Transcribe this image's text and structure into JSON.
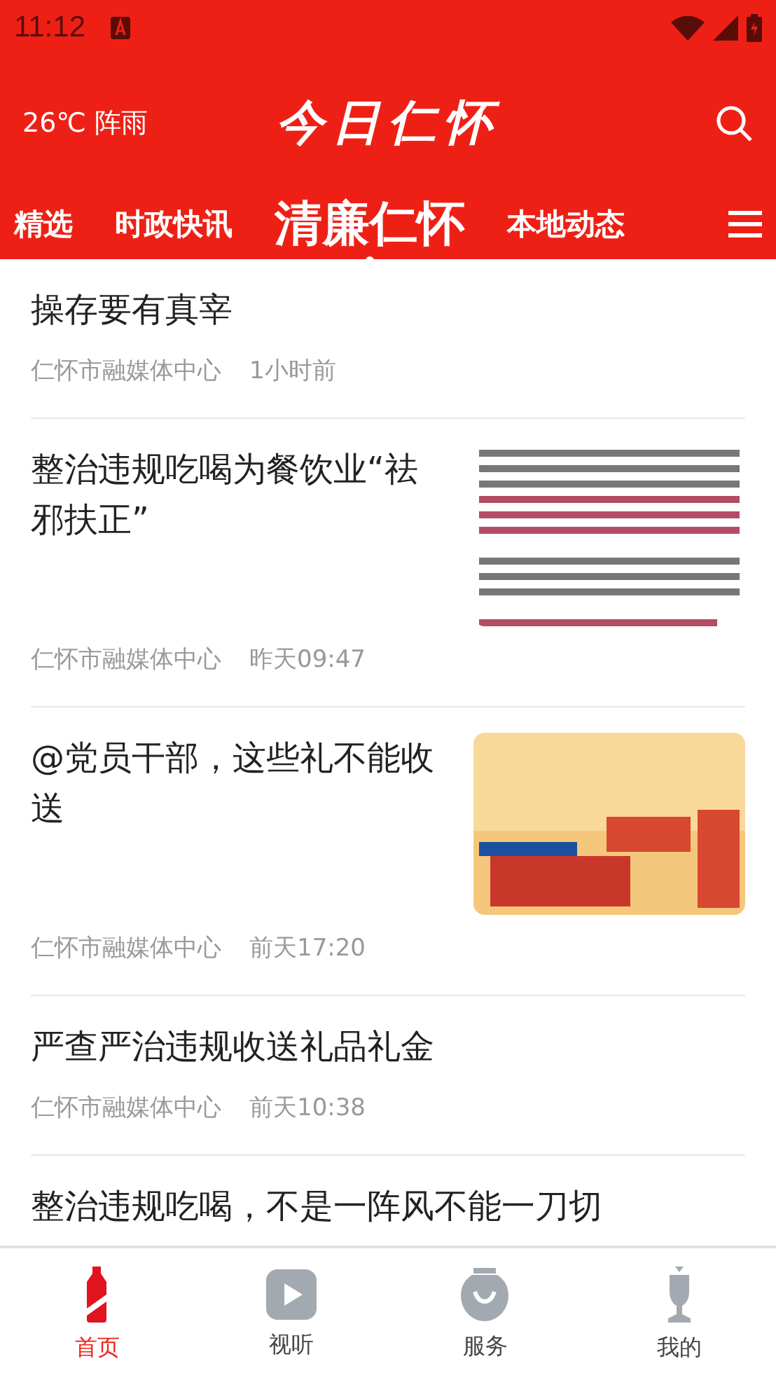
{
  "status_bar": {
    "time": "11:12"
  },
  "header": {
    "weather": "26℃ 阵雨",
    "logo": "今日仁怀"
  },
  "tabs": [
    {
      "label": "精选",
      "selected": false
    },
    {
      "label": "时政快讯",
      "selected": false
    },
    {
      "label": "清廉仁怀",
      "selected": true
    },
    {
      "label": "本地动态",
      "selected": false
    }
  ],
  "articles": [
    {
      "title": "操存要有真宰",
      "source": "仁怀市融媒体中心",
      "time": "1小时前"
    },
    {
      "title": "整治违规吃喝为餐饮业“祛邪扶正”",
      "source": "仁怀市融媒体中心",
      "time": "昨天09:47",
      "thumbnail": {
        "kind": "document"
      }
    },
    {
      "title": "@党员干部，这些礼不能收送",
      "source": "仁怀市融媒体中心",
      "time": "前天17:20",
      "thumbnail": {
        "kind": "poster"
      }
    },
    {
      "title": "严查严治违规收送礼品礼金",
      "source": "仁怀市融媒体中心",
      "time": "前天10:38"
    },
    {
      "title": "整治违规吃喝，不是一阵风不能一刀切"
    }
  ],
  "bottom_nav": [
    {
      "label": "首页",
      "selected": true
    },
    {
      "label": "视听",
      "selected": false
    },
    {
      "label": "服务",
      "selected": false
    },
    {
      "label": "我的",
      "selected": false
    }
  ]
}
